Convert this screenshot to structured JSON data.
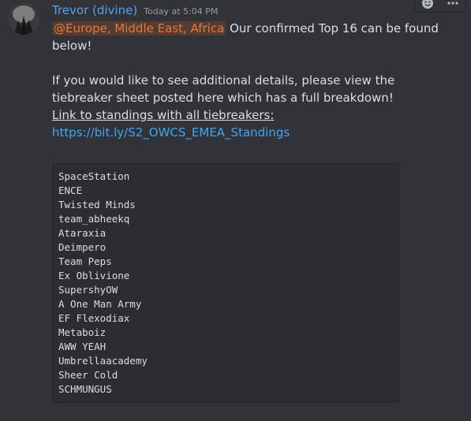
{
  "message": {
    "author": "Trevor (divine)",
    "timestamp": "Today at 5:04 PM",
    "mention": "@Europe, Middle East, Africa",
    "line1_after_mention": " Our confirmed Top 16 can be found below!",
    "paragraph2": "If you would like to see additional details, please view the tiebreaker sheet posted here which has a full breakdown!",
    "standings_link_label": "Link to standings with all tiebreakers:",
    "standings_url": "https://bit.ly/S2_OWCS_EMEA_Standings",
    "teams": [
      "SpaceStation",
      "ENCE",
      "Twisted Minds",
      "team_abheekq",
      "Ataraxia",
      "Deimpero",
      "Team Peps",
      "Ex Oblivione",
      "SupershyOW",
      "A One Man Army",
      "EF Flexodiax",
      "Metaboiz",
      "AWW YEAH",
      "Umbrellaacademy",
      "Sheer Cold",
      "SCHMUNGUS"
    ]
  },
  "toolbar": {
    "icons": [
      "add-reaction-icon",
      "more-options-icon"
    ]
  },
  "colors": {
    "background": "#313338",
    "username": "#5a9fe8",
    "mention_text": "#e07a3d",
    "link": "#3fa7f0",
    "codeblock_bg": "#2b2d31"
  }
}
